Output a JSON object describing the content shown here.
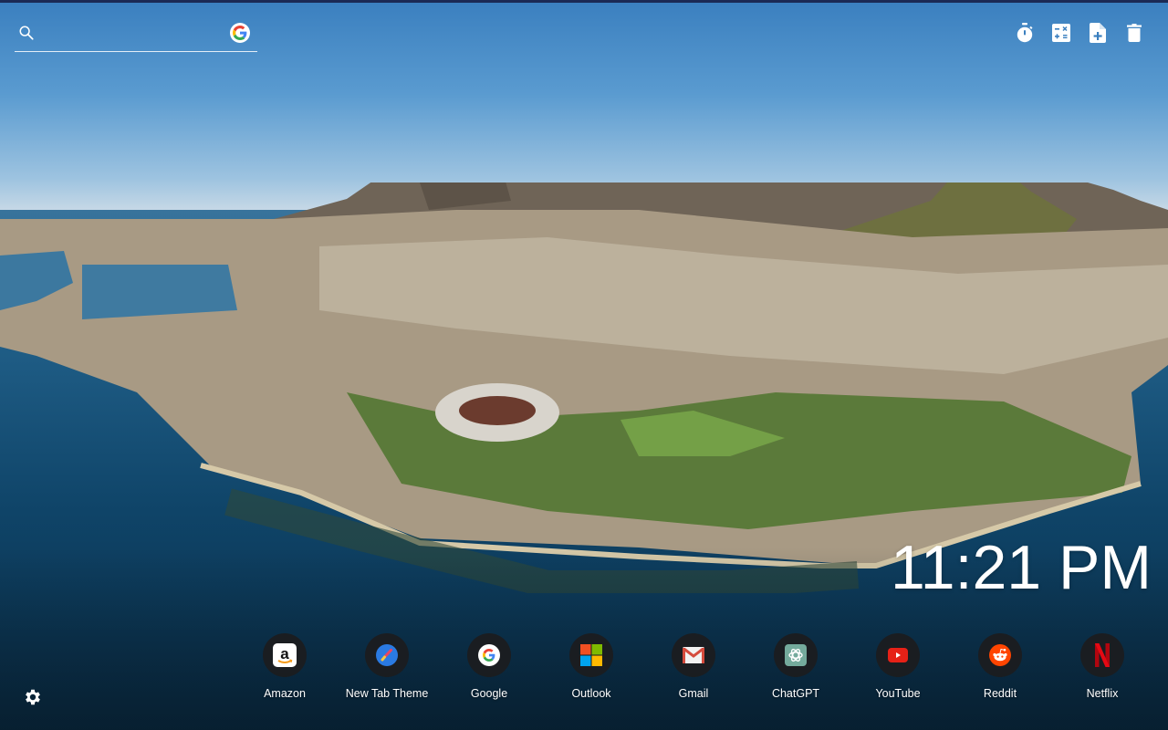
{
  "search": {
    "placeholder": "",
    "value": "",
    "search_icon": "search-icon",
    "engine_icon": "google-g-icon"
  },
  "toolbar": {
    "items": [
      {
        "name": "timer",
        "icon": "stopwatch-icon"
      },
      {
        "name": "calculator",
        "icon": "calculator-icon"
      },
      {
        "name": "new-note",
        "icon": "note-add-icon"
      },
      {
        "name": "delete",
        "icon": "trash-icon"
      }
    ]
  },
  "clock": {
    "time": "11:21 PM"
  },
  "shortcuts": [
    {
      "label": "Amazon",
      "icon": "amazon-icon"
    },
    {
      "label": "New Tab Theme",
      "icon": "paintbrush-icon"
    },
    {
      "label": "Google",
      "icon": "google-icon"
    },
    {
      "label": "Outlook",
      "icon": "microsoft-icon"
    },
    {
      "label": "Gmail",
      "icon": "gmail-icon"
    },
    {
      "label": "ChatGPT",
      "icon": "chatgpt-icon"
    },
    {
      "label": "YouTube",
      "icon": "youtube-icon"
    },
    {
      "label": "Reddit",
      "icon": "reddit-icon"
    },
    {
      "label": "Netflix",
      "icon": "netflix-icon"
    }
  ],
  "settings": {
    "icon": "gear-icon"
  },
  "background": {
    "description": "Aerial view of Cape Town with Table Mountain"
  }
}
